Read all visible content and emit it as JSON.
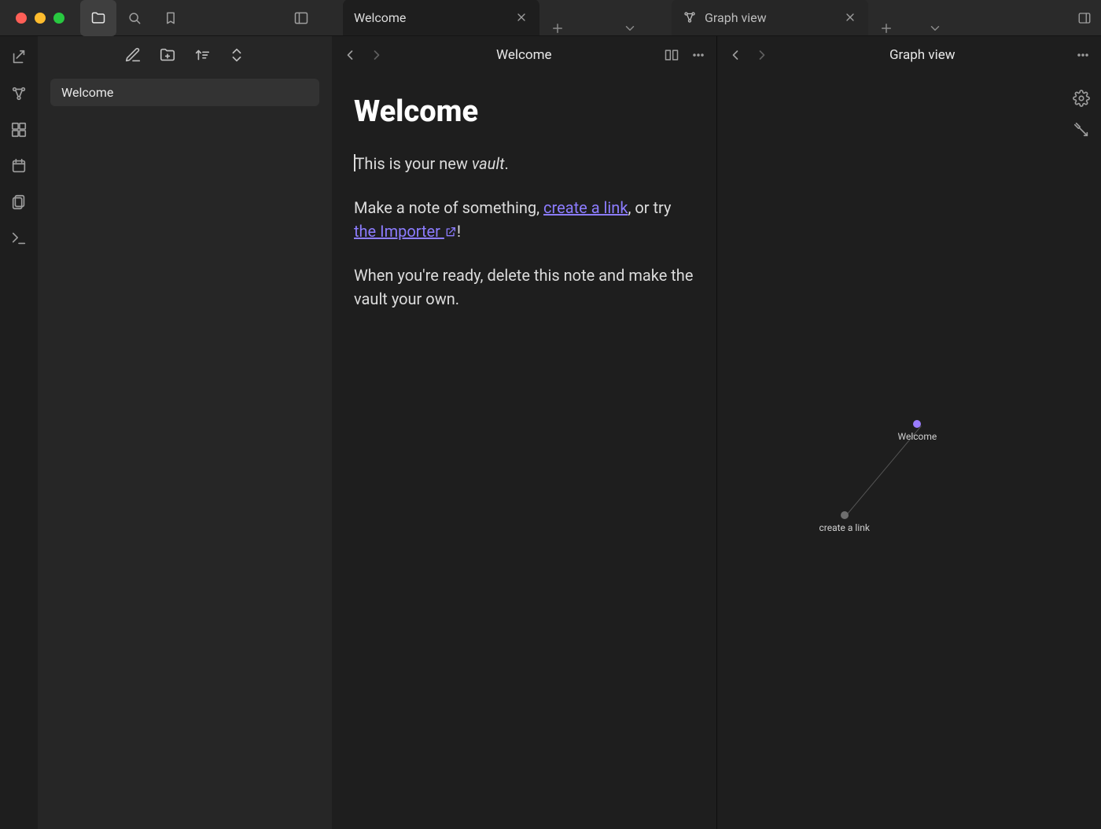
{
  "tabs": {
    "left": {
      "label": "Welcome"
    },
    "right": {
      "label": "Graph view"
    }
  },
  "nav": {
    "files": [
      "Welcome"
    ]
  },
  "editor": {
    "view_title": "Welcome",
    "heading": "Welcome",
    "p1_a": "This is your new ",
    "p1_em": "vault",
    "p1_b": ".",
    "p2_a": "Make a note of something, ",
    "p2_link1": "create a link",
    "p2_b": ", or try ",
    "p2_link2": "the Importer",
    "p2_c": "!",
    "p3": "When you're ready, delete this note and make the vault your own."
  },
  "graph": {
    "view_title": "Graph view",
    "nodes": {
      "welcome": "Welcome",
      "create_link": "create a link"
    }
  }
}
